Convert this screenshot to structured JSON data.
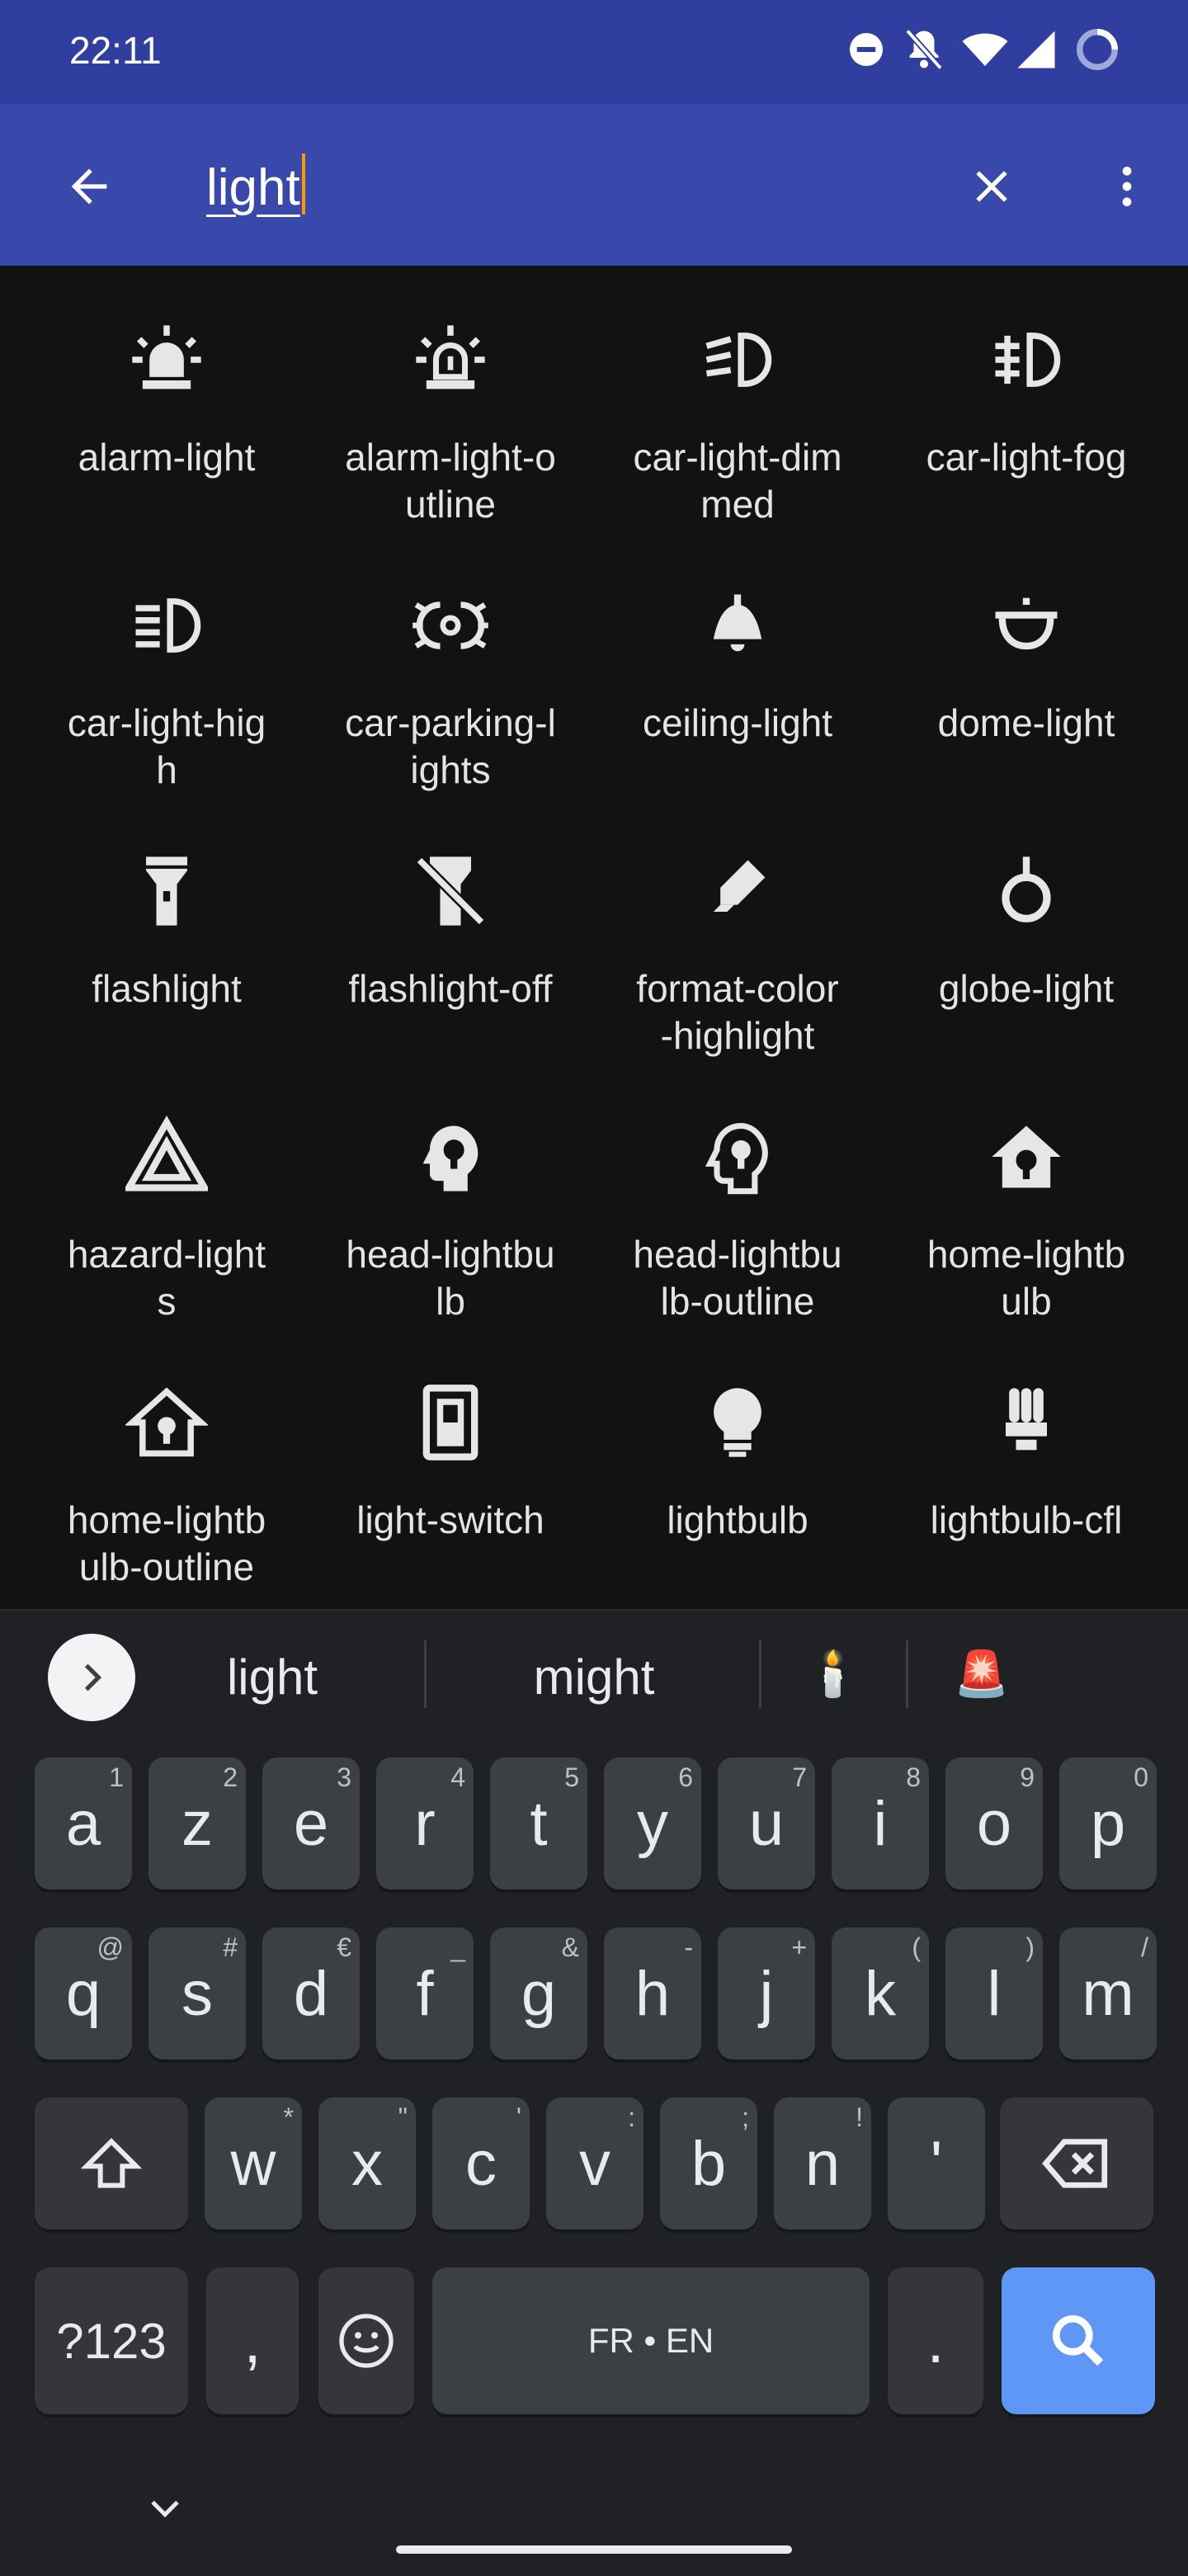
{
  "status_bar": {
    "time": "22:11",
    "icons": [
      "do-not-disturb-icon",
      "bell-off-icon",
      "wifi-icon",
      "cell-signal-icon",
      "battery-ring-icon"
    ]
  },
  "search": {
    "query": "light",
    "caret_color": "#ff9800"
  },
  "results": [
    {
      "name": "alarm-light",
      "label": "alarm-light",
      "icon": "alarm-light-icon"
    },
    {
      "name": "alarm-light-outline",
      "label": "alarm-light-o\nutline",
      "icon": "alarm-light-outline-icon"
    },
    {
      "name": "car-light-dimmed",
      "label": "car-light-dim\nmed",
      "icon": "car-light-dimmed-icon"
    },
    {
      "name": "car-light-fog",
      "label": "car-light-fog",
      "icon": "car-light-fog-icon"
    },
    {
      "name": "car-light-high",
      "label": "car-light-hig\nh",
      "icon": "car-light-high-icon"
    },
    {
      "name": "car-parking-lights",
      "label": "car-parking-l\nights",
      "icon": "car-parking-lights-icon"
    },
    {
      "name": "ceiling-light",
      "label": "ceiling-light",
      "icon": "ceiling-light-icon"
    },
    {
      "name": "dome-light",
      "label": "dome-light",
      "icon": "dome-light-icon"
    },
    {
      "name": "flashlight",
      "label": "flashlight",
      "icon": "flashlight-icon"
    },
    {
      "name": "flashlight-off",
      "label": "flashlight-off",
      "icon": "flashlight-off-icon"
    },
    {
      "name": "format-color-highlight",
      "label": "format-color\n-highlight",
      "icon": "format-color-highlight-icon"
    },
    {
      "name": "globe-light",
      "label": "globe-light",
      "icon": "globe-light-icon"
    },
    {
      "name": "hazard-lights",
      "label": "hazard-light\ns",
      "icon": "hazard-lights-icon"
    },
    {
      "name": "head-lightbulb",
      "label": "head-lightbu\nlb",
      "icon": "head-lightbulb-icon"
    },
    {
      "name": "head-lightbulb-outline",
      "label": "head-lightbu\nlb-outline",
      "icon": "head-lightbulb-outline-icon"
    },
    {
      "name": "home-lightbulb",
      "label": "home-lightb\nulb",
      "icon": "home-lightbulb-icon"
    },
    {
      "name": "home-lightbulb-outline",
      "label": "home-lightb\nulb-outline",
      "icon": "home-lightbulb-outline-icon"
    },
    {
      "name": "light-switch",
      "label": "light-switch",
      "icon": "light-switch-icon"
    },
    {
      "name": "lightbulb",
      "label": "lightbulb",
      "icon": "lightbulb-icon"
    },
    {
      "name": "lightbulb-cfl",
      "label": "lightbulb-cfl",
      "icon": "lightbulb-cfl-icon"
    }
  ],
  "keyboard": {
    "suggestions": [
      "light",
      "might",
      "🕯️",
      "🚨"
    ],
    "rows": [
      [
        {
          "k": "a",
          "h": "1"
        },
        {
          "k": "z",
          "h": "2"
        },
        {
          "k": "e",
          "h": "3"
        },
        {
          "k": "r",
          "h": "4"
        },
        {
          "k": "t",
          "h": "5"
        },
        {
          "k": "y",
          "h": "6"
        },
        {
          "k": "u",
          "h": "7"
        },
        {
          "k": "i",
          "h": "8"
        },
        {
          "k": "o",
          "h": "9"
        },
        {
          "k": "p",
          "h": "0"
        }
      ],
      [
        {
          "k": "q",
          "h": "@"
        },
        {
          "k": "s",
          "h": "#"
        },
        {
          "k": "d",
          "h": "€"
        },
        {
          "k": "f",
          "h": "_"
        },
        {
          "k": "g",
          "h": "&"
        },
        {
          "k": "h",
          "h": "-"
        },
        {
          "k": "j",
          "h": "+"
        },
        {
          "k": "k",
          "h": "("
        },
        {
          "k": "l",
          "h": ")"
        },
        {
          "k": "m",
          "h": "/"
        }
      ],
      [
        {
          "k": "w",
          "h": "*"
        },
        {
          "k": "x",
          "h": "\""
        },
        {
          "k": "c",
          "h": "'"
        },
        {
          "k": "v",
          "h": ":"
        },
        {
          "k": "b",
          "h": ";"
        },
        {
          "k": "n",
          "h": "!"
        },
        {
          "k": "'",
          "h": ""
        }
      ]
    ],
    "symbols_label": "?123",
    "comma_label": ",",
    "space_label": "FR • EN",
    "period_label": ".",
    "accent_color": "#5e97f6"
  }
}
